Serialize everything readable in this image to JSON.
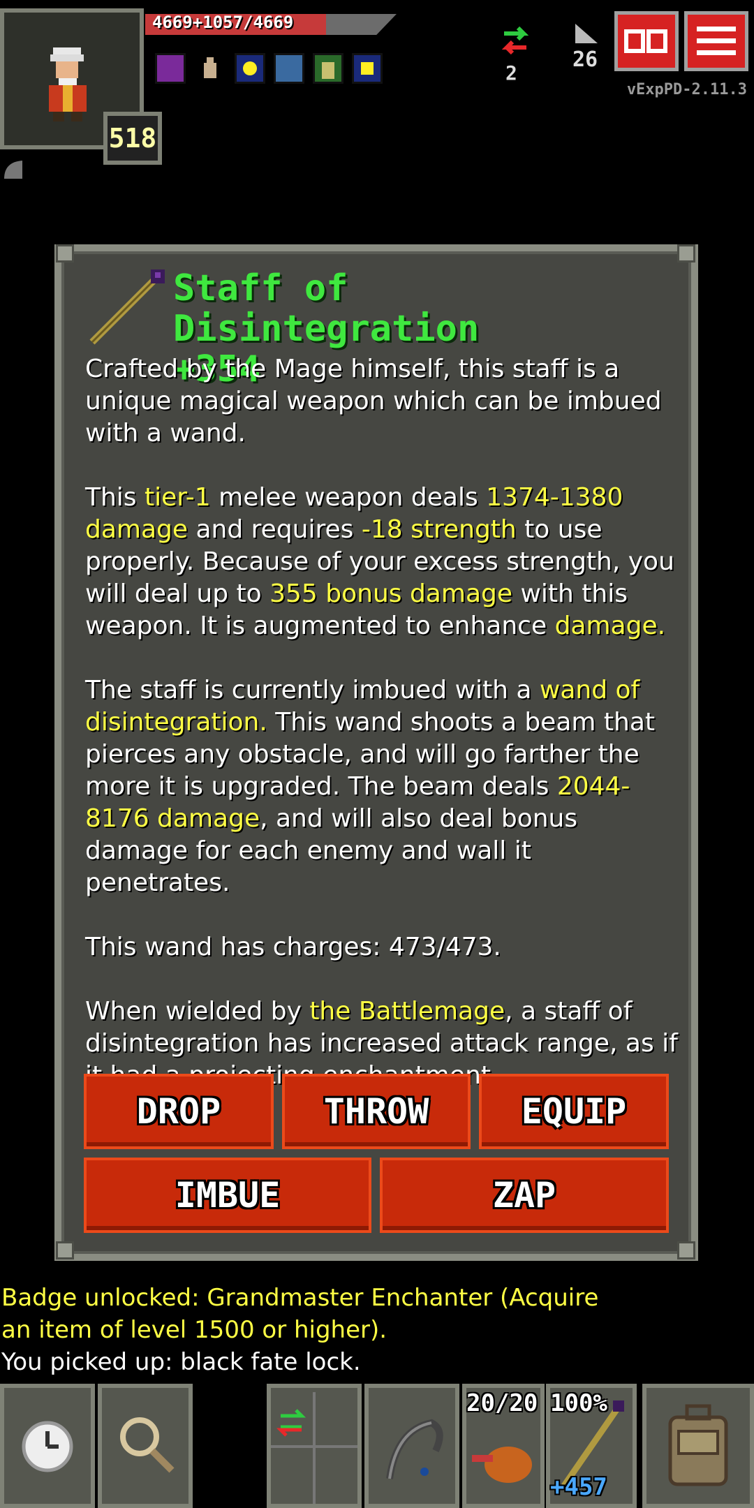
{
  "hud": {
    "hp_text": "4669+1057/4669",
    "hero_level": "518",
    "journal_count": "2",
    "depth": "26",
    "version": "vExpPD-2.11.3",
    "buffs": [
      "shield-buff-icon",
      "hand-buff-icon",
      "light-buff-icon",
      "barrier-buff-icon",
      "tower-buff-icon",
      "bless-buff-icon"
    ]
  },
  "item": {
    "name": "Staff of Disintegration",
    "level": "+354",
    "paragraphs": {
      "p1": "Crafted by the Mage himself, this staff is a unique magical weapon which can be imbued with a wand.",
      "p2_a": "This ",
      "p2_tier": "tier-1",
      "p2_b": " melee weapon deals ",
      "p2_damage": "1374-1380 damage",
      "p2_c": " and requires ",
      "p2_strength": "-18 strength",
      "p2_d": " to use properly. Because of your excess strength, you will deal up to ",
      "p2_bonus": "355 bonus damage",
      "p2_e": " with this weapon. It is augmented to enhance ",
      "p2_aug": "damage.",
      "p3_a": "The staff is currently imbued with a ",
      "p3_wand": "wand of disintegration.",
      "p3_b": " This wand shoots a beam that pierces any obstacle, and will go farther the more it is upgraded. The beam deals ",
      "p3_damage": "2044-8176 damage",
      "p3_c": ", and will also deal bonus damage for each enemy and wall it penetrates.",
      "p4": "This wand has charges: 473/473.",
      "p5_a": "When wielded by ",
      "p5_class": "the Battlemage",
      "p5_b": ", a staff of disintegration has increased attack range, as if it had a projecting enchantment."
    },
    "buttons": {
      "drop": "DROP",
      "throw": "THROW",
      "equip": "EQUIP",
      "imbue": "IMBUE",
      "zap": "ZAP"
    }
  },
  "log": {
    "line1": "Badge unlocked: Grandmaster Enchanter (Acquire",
    "line2": "an item of level 1500 or higher).",
    "line3": "You picked up: black fate lock."
  },
  "toolbar": {
    "quickslot_food": "20/20",
    "quickslot_staff_charge": "100%",
    "quickslot_staff_level": "+457"
  },
  "colors": {
    "title_green": "#3fe83f",
    "highlight_yellow": "#ffff44",
    "button_red": "#c82a0a",
    "window_bg": "#464742"
  }
}
